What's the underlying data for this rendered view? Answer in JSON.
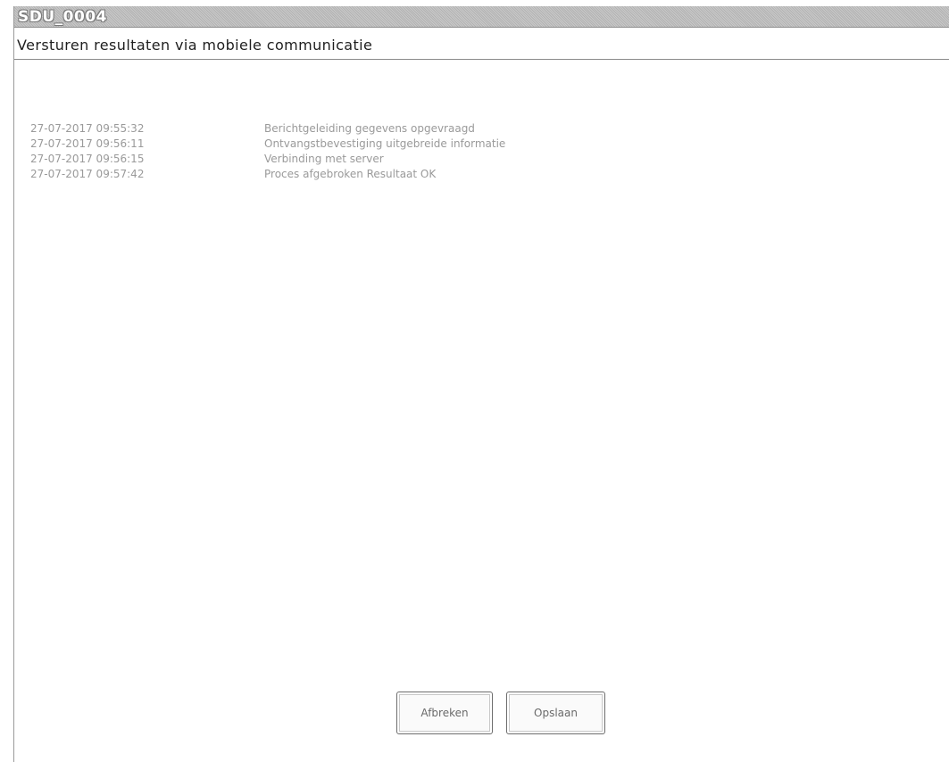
{
  "window": {
    "title": "SDU_0004",
    "subtitle": "Versturen resultaten via mobiele communicatie"
  },
  "log": {
    "entries": [
      {
        "timestamp": "27-07-2017  09:55:32",
        "message": "Berichtgeleiding gegevens opgevraagd"
      },
      {
        "timestamp": "27-07-2017  09:56:11",
        "message": "Ontvangstbevestiging uitgebreide informatie"
      },
      {
        "timestamp": "27-07-2017  09:56:15",
        "message": "Verbinding met server"
      },
      {
        "timestamp": "27-07-2017  09:57:42",
        "message": "Proces afgebroken Resultaat OK"
      }
    ]
  },
  "buttons": {
    "cancel_label": "Afbreken",
    "save_label": "Opslaan"
  }
}
